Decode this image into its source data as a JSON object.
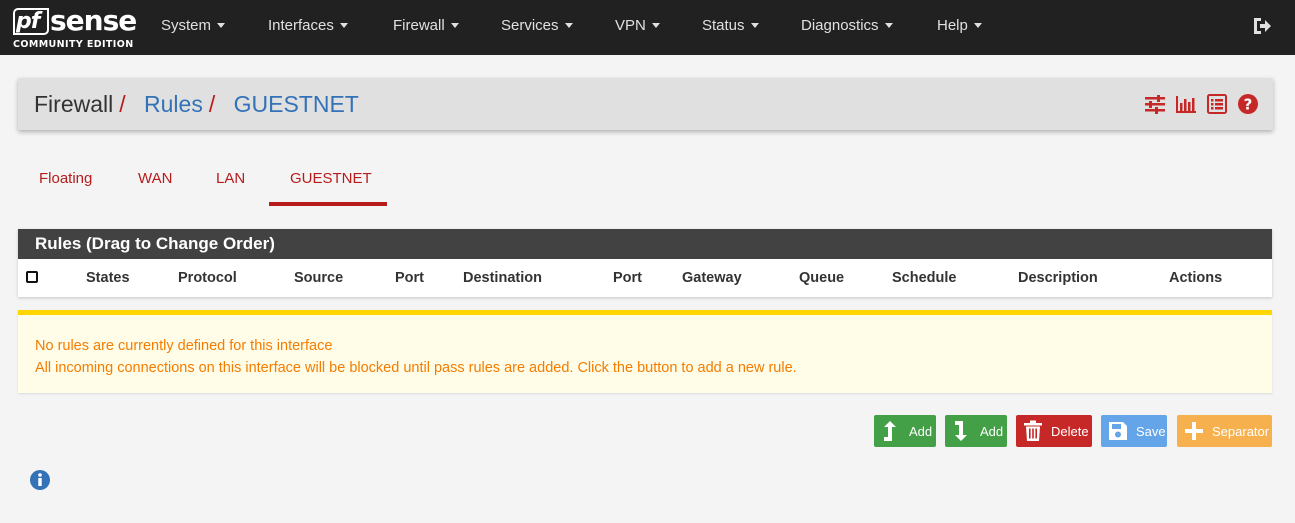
{
  "brand": {
    "logo_pf": "pf",
    "logo_sense": "sense",
    "edition": "COMMUNITY EDITION"
  },
  "nav": {
    "items": [
      {
        "label": "System"
      },
      {
        "label": "Interfaces"
      },
      {
        "label": "Firewall"
      },
      {
        "label": "Services"
      },
      {
        "label": "VPN"
      },
      {
        "label": "Status"
      },
      {
        "label": "Diagnostics"
      },
      {
        "label": "Help"
      }
    ],
    "logout_icon": "sign-out-icon"
  },
  "breadcrumb": {
    "root": "Firewall",
    "sep": "/",
    "level2": "Rules",
    "level3": "GUESTNET",
    "icons": [
      "sliders-icon",
      "bar-chart-icon",
      "list-icon",
      "question-circle-icon"
    ]
  },
  "tabs": [
    {
      "label": "Floating"
    },
    {
      "label": "WAN"
    },
    {
      "label": "LAN"
    },
    {
      "label": "GUESTNET",
      "active": true
    }
  ],
  "rules_table": {
    "title": "Rules (Drag to Change Order)",
    "columns": [
      "States",
      "Protocol",
      "Source",
      "Port",
      "Destination",
      "Port",
      "Gateway",
      "Queue",
      "Schedule",
      "Description",
      "Actions"
    ]
  },
  "alert": {
    "line1": "No rules are currently defined for this interface",
    "line2": "All incoming connections on this interface will be blocked until pass rules are added. Click the button to add a new rule."
  },
  "buttons": {
    "add_top": "Add",
    "add_bottom": "Add",
    "delete": "Delete",
    "save": "Save",
    "separator": "Separator"
  },
  "colors": {
    "navbar": "#212121",
    "accent_red": "#b71c1c",
    "link_blue": "#3472b8",
    "alert_text": "#f57c00",
    "alert_border": "#ffd600",
    "btn_green": "#43a047",
    "btn_red": "#c62828",
    "btn_blue": "#64a4e8",
    "btn_orange": "#f6b04d"
  },
  "info_icon": "info-circle-icon"
}
